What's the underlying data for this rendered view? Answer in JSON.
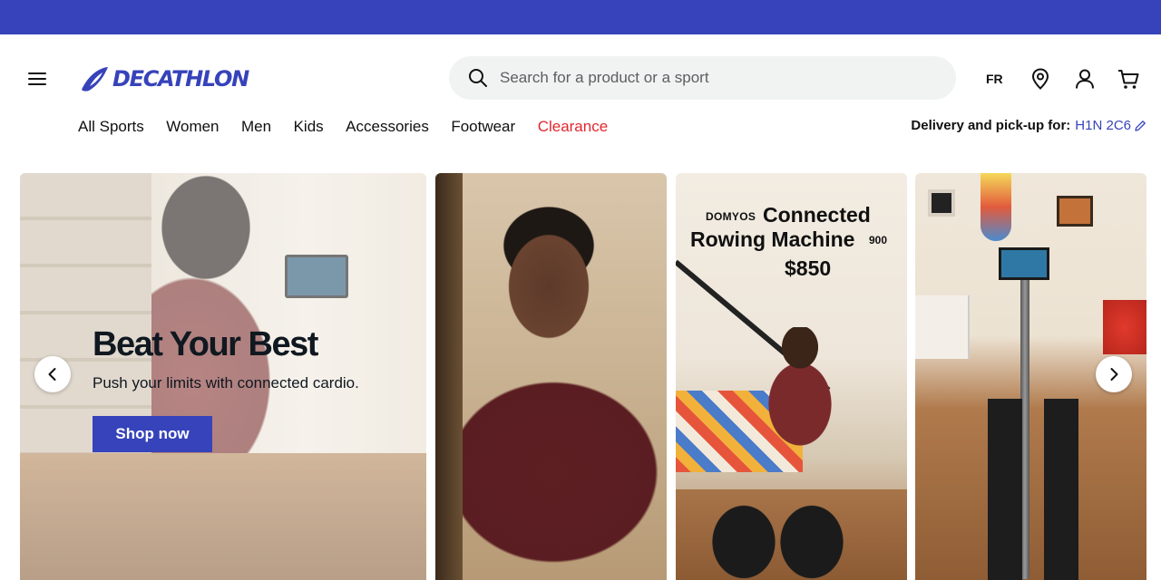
{
  "brand": {
    "name": "DECATHLON",
    "color": "#3643ba"
  },
  "header": {
    "search_placeholder": "Search for a product or a sport",
    "language": "FR",
    "icons": [
      "menu-icon",
      "search-icon",
      "store-location-icon",
      "account-icon",
      "cart-icon"
    ]
  },
  "nav": {
    "items": [
      "All Sports",
      "Women",
      "Men",
      "Kids",
      "Accessories",
      "Footwear",
      "Clearance"
    ],
    "clearance_color": "#e3262f"
  },
  "delivery": {
    "label": "Delivery and pick-up for:",
    "postal_code": "H1N 2C6"
  },
  "hero": {
    "title": "Beat Your Best",
    "subtitle": "Push your limits with connected cardio.",
    "cta": "Shop now"
  },
  "promo": {
    "brand": "DOMYOS",
    "name_line1": "Connected",
    "name_line2": "Rowing Machine",
    "model": "900",
    "price": "$850"
  },
  "carousel": {
    "prev_icon": "chevron-left-icon",
    "next_icon": "chevron-right-icon"
  }
}
